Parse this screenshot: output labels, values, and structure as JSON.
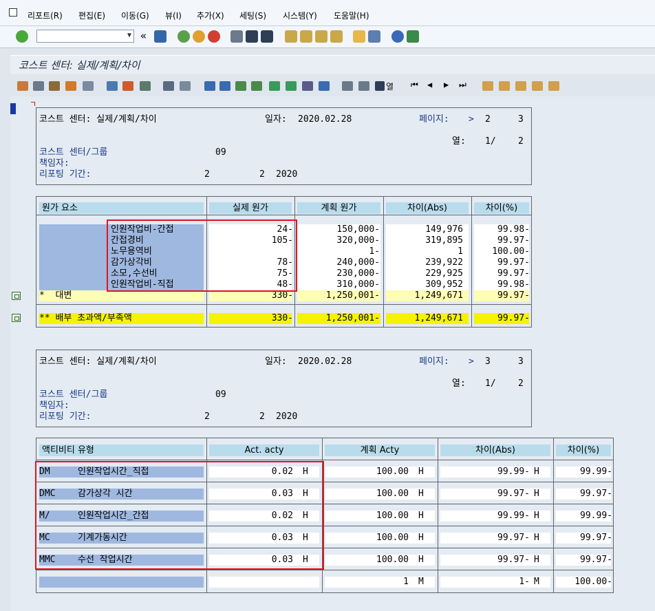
{
  "menu": [
    "리포트(R)",
    "편집(E)",
    "이동(G)",
    "뷰(I)",
    "추가(X)",
    "세팅(S)",
    "시스템(Y)",
    "도움말(H)"
  ],
  "toolbar": {
    "nav_arrow": "«"
  },
  "title": "코스트 센터: 실제/계획/차이",
  "alv_detail_label": "열",
  "report1": {
    "line1_left": "코스트 센터: 실제/계획/차이",
    "date_label": "일자:",
    "date": "2020.02.28",
    "page_label": "페이지:",
    "page_arrow": ">",
    "page_cur": "2",
    "page_total": "3",
    "col_label": "열:",
    "col_cur": "1/",
    "col_total": "2",
    "cc_label": "코스트 센터/그룹",
    "cc_value": "09",
    "resp_label": "책임자:",
    "period_label": "리포팅 기간:",
    "period_from": "2",
    "period_to": "2",
    "period_year": "2020",
    "headers": [
      "원가 요소",
      "실제 원가",
      "계획 원가",
      "차이(Abs)",
      "차이(%)"
    ],
    "rows": [
      {
        "name": "인원작업비-간접",
        "actual": "24-",
        "plan": "150,000-",
        "abs": "149,976",
        "pct": "99.98-"
      },
      {
        "name": "간접경비",
        "actual": "105-",
        "plan": "320,000-",
        "abs": "319,895",
        "pct": "99.97-"
      },
      {
        "name": "노무용역비",
        "actual": "",
        "plan": "1-",
        "abs": "1",
        "pct": "100.00-"
      },
      {
        "name": "감가상각비",
        "actual": "78-",
        "plan": "240,000-",
        "abs": "239,922",
        "pct": "99.97-"
      },
      {
        "name": "소모,수선비",
        "actual": "75-",
        "plan": "230,000-",
        "abs": "229,925",
        "pct": "99.97-"
      },
      {
        "name": "인원작업비-직접",
        "actual": "48-",
        "plan": "310,000-",
        "abs": "309,952",
        "pct": "99.98-"
      }
    ],
    "subtotal": {
      "label": "*  대변",
      "actual": "330-",
      "plan": "1,250,001-",
      "abs": "1,249,671",
      "pct": "99.97-"
    },
    "total": {
      "label": "** 배부 초과액/부족액",
      "actual": "330-",
      "plan": "1,250,001-",
      "abs": "1,249,671",
      "pct": "99.97-"
    }
  },
  "report2": {
    "line1_left": "코스트 센터: 실제/계획/차이",
    "date_label": "일자:",
    "date": "2020.02.28",
    "page_label": "페이지:",
    "page_arrow": ">",
    "page_cur": "3",
    "page_total": "3",
    "col_label": "열:",
    "col_cur": "1/",
    "col_total": "2",
    "cc_label": "코스트 센터/그룹",
    "cc_value": "09",
    "resp_label": "책임자:",
    "period_label": "리포팅 기간:",
    "period_from": "2",
    "period_to": "2",
    "period_year": "2020",
    "headers": [
      "액티비티 유형",
      "Act. acty",
      "계획 Acty",
      "차이(Abs)",
      "차이(%)"
    ],
    "rows": [
      {
        "code": "DM",
        "name": "인원작업시간_직접",
        "actual": "0.02",
        "unit1": "H",
        "plan": "100.00",
        "unit2": "H",
        "abs": "99.99-",
        "unit3": "H",
        "pct": "99.99-"
      },
      {
        "code": "DMC",
        "name": "감가상각 시간",
        "actual": "0.03",
        "unit1": "H",
        "plan": "100.00",
        "unit2": "H",
        "abs": "99.97-",
        "unit3": "H",
        "pct": "99.97-"
      },
      {
        "code": "M/",
        "name": "인원작업시간_간접",
        "actual": "0.02",
        "unit1": "H",
        "plan": "100.00",
        "unit2": "H",
        "abs": "99.99-",
        "unit3": "H",
        "pct": "99.99-"
      },
      {
        "code": "MC",
        "name": "기계가동시간",
        "actual": "0.03",
        "unit1": "H",
        "plan": "100.00",
        "unit2": "H",
        "abs": "99.97-",
        "unit3": "H",
        "pct": "99.97-"
      },
      {
        "code": "MMC",
        "name": "수선 작업시간",
        "actual": "0.03",
        "unit1": "H",
        "plan": "100.00",
        "unit2": "H",
        "abs": "99.97-",
        "unit3": "H",
        "pct": "99.97-"
      }
    ],
    "last": {
      "plan": "1",
      "unit2": "M",
      "abs": "1-",
      "unit3": "M",
      "pct": "100.00-"
    }
  }
}
